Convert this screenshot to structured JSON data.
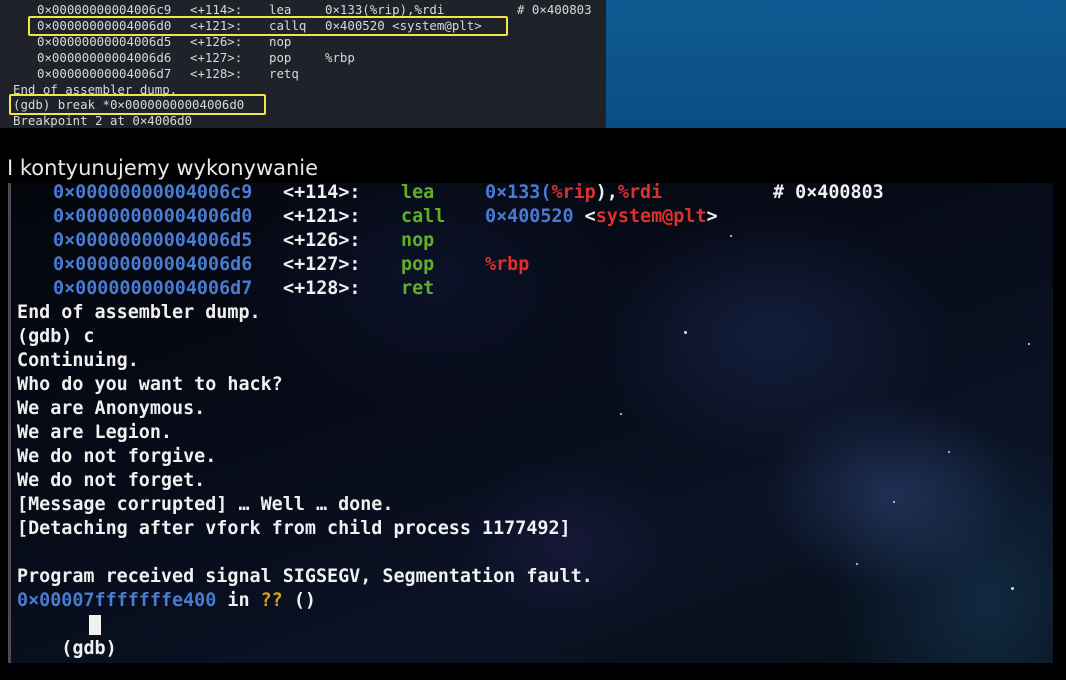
{
  "top_terminal": {
    "rows": [
      {
        "addr": "0×00000000004006c9",
        "off": "<+114>:",
        "mnem": "lea",
        "ops": "0×133(%rip),%rdi",
        "comment": "# 0×400803"
      },
      {
        "addr": "0×00000000004006d0",
        "off": "<+121>:",
        "mnem": "callq",
        "ops": "0×400520 <system@plt>",
        "comment": ""
      },
      {
        "addr": "0×00000000004006d5",
        "off": "<+126>:",
        "mnem": "nop",
        "ops": "",
        "comment": ""
      },
      {
        "addr": "0×00000000004006d6",
        "off": "<+127>:",
        "mnem": "pop",
        "ops": "%rbp",
        "comment": ""
      },
      {
        "addr": "0×00000000004006d7",
        "off": "<+128>:",
        "mnem": "retq",
        "ops": "",
        "comment": ""
      }
    ],
    "end_line": "End of assembler dump.",
    "break_cmd": "(gdb) break *0×00000000004006d0",
    "breakpoint_line": "Breakpoint 2 at 0×4006d0"
  },
  "caption": "I kontyunujemy wykonywanie",
  "main_terminal": {
    "rows": [
      {
        "addr": "0×00000000004006c9",
        "off": "<+114>:",
        "mnem": "lea",
        "ops_num": "0×133(",
        "ops_reg1": "%rip",
        "ops_mid": "),",
        "ops_reg2": "%rdi",
        "comment": "# 0×400803"
      },
      {
        "addr": "0×00000000004006d0",
        "off": "<+121>:",
        "mnem": "call",
        "ops_num": "0×400520",
        "ops_lt": " <",
        "ops_sym": "system@plt",
        "ops_gt": ">"
      },
      {
        "addr": "0×00000000004006d5",
        "off": "<+126>:",
        "mnem": "nop"
      },
      {
        "addr": "0×00000000004006d6",
        "off": "<+127>:",
        "mnem": "pop",
        "ops_reg": "%rbp"
      },
      {
        "addr": "0×00000000004006d7",
        "off": "<+128>:",
        "mnem": "ret"
      }
    ],
    "lines": [
      "End of assembler dump.",
      "(gdb) c",
      "Continuing.",
      "Who do you want to hack?",
      "We are Anonymous.",
      "We are Legion.",
      "We do not forgive.",
      "We do not forget.",
      "[Message corrupted] … Well … done.",
      "[Detaching after vfork from child process 1177492]",
      "",
      "Program received signal SIGSEGV, Segmentation fault."
    ],
    "fault": {
      "addr": "0×00007fffffffe400",
      "in": " in ",
      "fn": "??",
      "args": " ()"
    },
    "prompt": "(gdb) "
  }
}
